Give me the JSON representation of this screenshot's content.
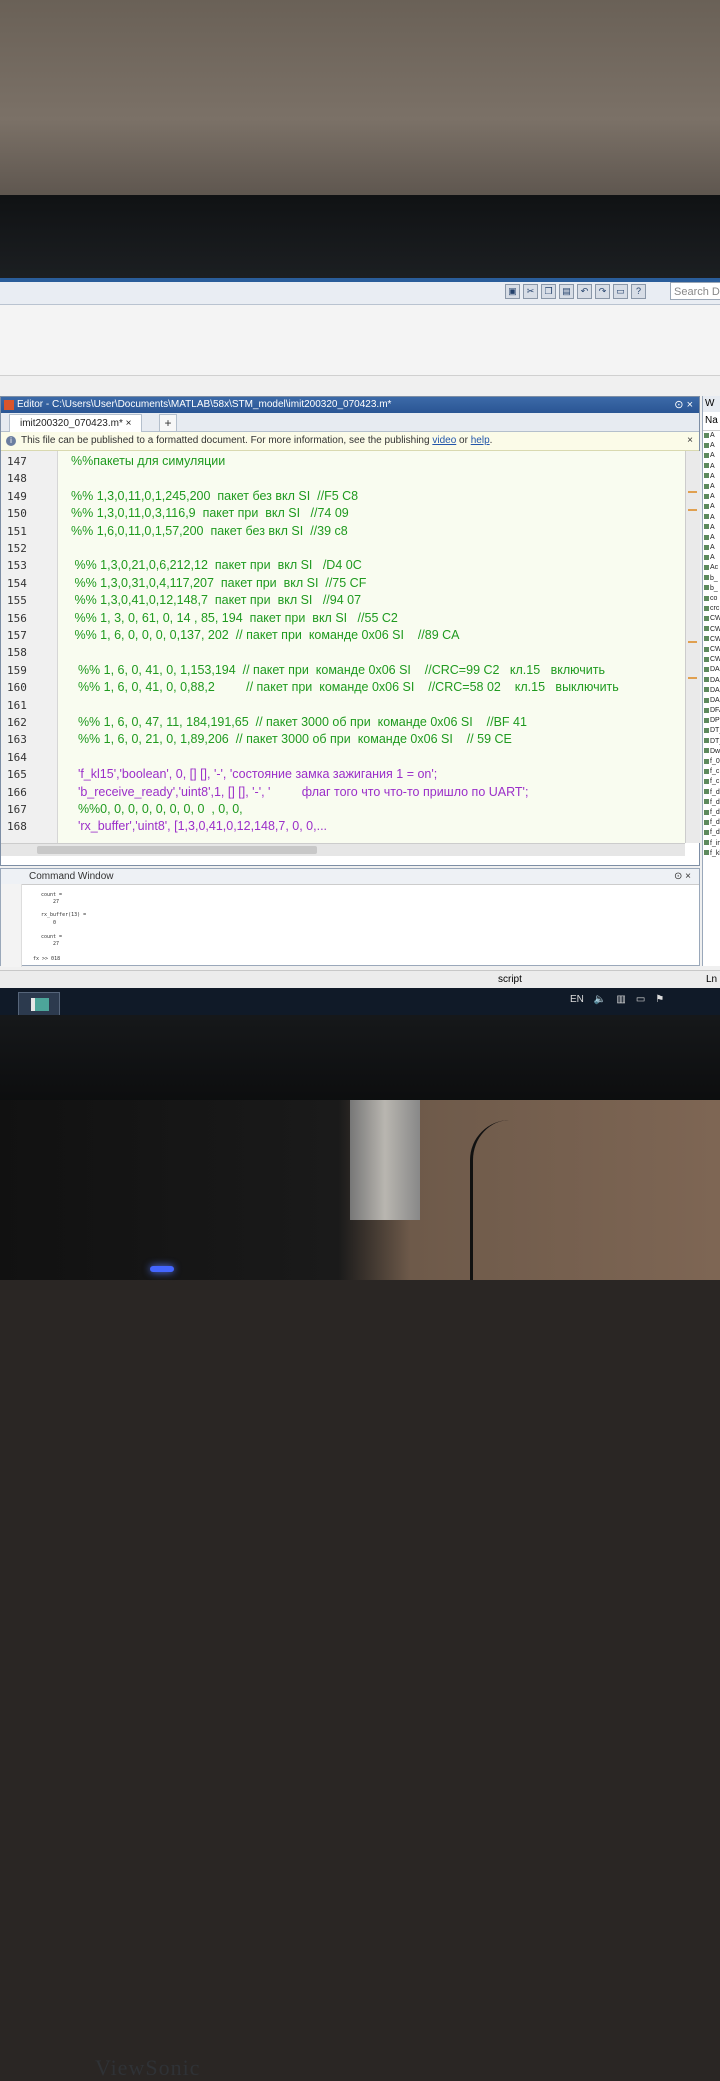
{
  "editor": {
    "title": "Editor - C:\\Users\\User\\Documents\\MATLAB\\58x\\STM_model\\imit200320_070423.m*",
    "tab_label": "imit200320_070423.m*",
    "tab_add": "+",
    "info_text": "This file can be published to a formatted document. For more information, see the publishing",
    "info_link_video": "video",
    "info_or": "or",
    "info_link_help": "help",
    "close_symbol": "×",
    "lines": [
      {
        "n": "147",
        "text": "%%пакеты для симуляции",
        "cls": "cm"
      },
      {
        "n": "148",
        "text": "",
        "cls": "cm"
      },
      {
        "n": "149",
        "text": "%% 1,3,0,11,0,1,245,200  пакет без вкл SI  //F5 C8",
        "cls": "cm"
      },
      {
        "n": "150",
        "text": "%% 1,3,0,11,0,3,116,9  пакет при  вкл SI   //74 09",
        "cls": "cm"
      },
      {
        "n": "151",
        "text": "%% 1,6,0,11,0,1,57,200  пакет без вкл SI  //39 c8",
        "cls": "cm"
      },
      {
        "n": "152",
        "text": "",
        "cls": "cm"
      },
      {
        "n": "153",
        "text": " %% 1,3,0,21,0,6,212,12  пакет при  вкл SI   /D4 0C",
        "cls": "cm"
      },
      {
        "n": "154",
        "text": " %% 1,3,0,31,0,4,117,207  пакет при  вкл SI  //75 CF",
        "cls": "cm"
      },
      {
        "n": "155",
        "text": " %% 1,3,0,41,0,12,148,7  пакет при  вкл SI   //94 07",
        "cls": "cm"
      },
      {
        "n": "156",
        "text": " %% 1, 3, 0, 61, 0, 14 , 85, 194  пакет при  вкл SI   //55 C2",
        "cls": "cm"
      },
      {
        "n": "157",
        "text": " %% 1, 6, 0, 0, 0, 0,137, 202  // пакет при  команде 0x06 SI    //89 CA",
        "cls": "cm"
      },
      {
        "n": "158",
        "text": "",
        "cls": "cm"
      },
      {
        "n": "159",
        "text": "  %% 1, 6, 0, 41, 0, 1,153,194  // пакет при  команде 0x06 SI    //CRC=99 C2   кл.15   включить",
        "cls": "cm"
      },
      {
        "n": "160",
        "text": "  %% 1, 6, 0, 41, 0, 0,88,2         // пакет при  команде 0x06 SI    //CRC=58 02    кл.15   выключить",
        "cls": "cm"
      },
      {
        "n": "161",
        "text": "",
        "cls": "cm"
      },
      {
        "n": "162",
        "text": "  %% 1, 6, 0, 47, 11, 184,191,65  // пакет 3000 об при  команде 0x06 SI    //BF 41",
        "cls": "cm"
      },
      {
        "n": "163",
        "text": "  %% 1, 6, 0, 21, 0, 1,89,206  // пакет 3000 об при  команде 0x06 SI    // 59 CE",
        "cls": "cm"
      },
      {
        "n": "164",
        "text": "",
        "cls": "cm"
      },
      {
        "n": "165",
        "text": "  'f_kl15','boolean', 0, [] [], '-', 'состояние замка зажигания 1 = on';",
        "cls": "sv"
      },
      {
        "n": "166",
        "text": "  'b_receive_ready','uint8',1, [] [], '-', '         флаг того что что-то пришло по UART';",
        "cls": "sv"
      },
      {
        "n": "167",
        "text": "  %%0, 0, 0, 0, 0, 0, 0, 0  , 0, 0,",
        "cls": "cm"
      },
      {
        "n": "168",
        "text": "  'rx_buffer','uint8', [1,3,0,41,0,12,148,7, 0, 0,...",
        "cls": "sv"
      }
    ]
  },
  "command_window": {
    "title": "Command Window",
    "lines": [
      "count =",
      "27",
      "rx_buffer(13) =",
      "0",
      "count =",
      "27"
    ],
    "prompt": "fx >> 018"
  },
  "status": {
    "script": "script",
    "ln": "Ln"
  },
  "search_placeholder": "Search D",
  "workspace": {
    "title": "W",
    "header": "Na",
    "items": [
      "A",
      "A",
      "A",
      "A",
      "A",
      "A",
      "A",
      "A",
      "A",
      "A",
      "A",
      "A",
      "A",
      "Ac",
      "b_",
      "b_",
      "co",
      "crc",
      "CW",
      "CW",
      "CW",
      "CW",
      "CW",
      "DA",
      "DA",
      "DA",
      "DA",
      "DFA",
      "DPK",
      "DT_",
      "DT_",
      "Dwk",
      "f_0",
      "f_c",
      "f_c",
      "f_d",
      "f_d",
      "f_d",
      "f_d",
      "f_d",
      "f_im",
      "f_kl"
    ]
  },
  "taskbar": {
    "lang": "EN"
  },
  "monitor_brand": "ViewSonic",
  "colors": {
    "comment": "#1f9a1f",
    "string": "#9b2fc9",
    "title_bar": "#2a5594"
  }
}
